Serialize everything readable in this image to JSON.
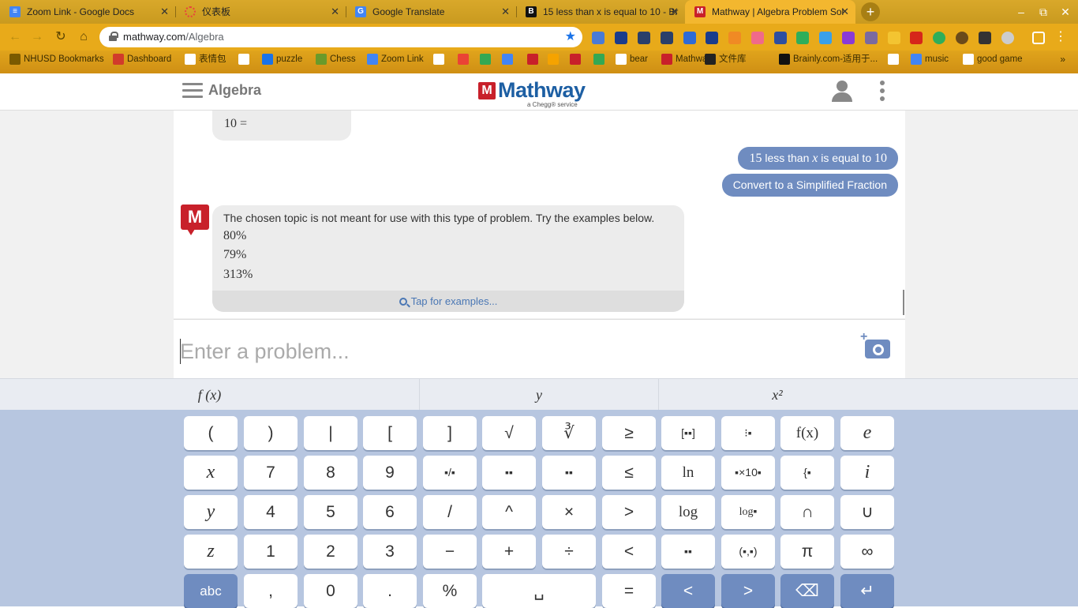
{
  "browser": {
    "tabs": [
      {
        "title": "Zoom Link - Google Docs",
        "color": "#4285f4",
        "active": false
      },
      {
        "title": "仪表板",
        "color": "#e8453c",
        "active": false
      },
      {
        "title": "Google Translate",
        "color": "#4285f4",
        "active": false
      },
      {
        "title": "15 less than x is equal to 10 - Br",
        "color": "#111111",
        "active": false
      },
      {
        "title": "Mathway | Algebra Problem Sol",
        "color": "#c8202a",
        "active": true
      }
    ],
    "new_tab": "+",
    "window_controls": [
      "–",
      "⧉",
      "✕"
    ],
    "address": {
      "host": "mathway.com",
      "path": "/Algebra"
    },
    "bookmarks": [
      {
        "label": "NHUSD Bookmarks",
        "color": "#7a5a00"
      },
      {
        "label": "Dashboard",
        "color": "#d13b2b"
      },
      {
        "label": "表情包",
        "color": "#ffffff"
      },
      {
        "label": "",
        "color": "#ffffff"
      },
      {
        "label": "puzzle",
        "color": "#1a73e8"
      },
      {
        "label": "Chess",
        "color": "#6a9a2a"
      },
      {
        "label": "Zoom Link",
        "color": "#4285f4"
      },
      {
        "label": "",
        "color": "#ffffff"
      },
      {
        "label": "",
        "color": "#ea4335"
      },
      {
        "label": "",
        "color": "#34a853"
      },
      {
        "label": "",
        "color": "#4285f4"
      },
      {
        "label": "",
        "color": "#c8202a"
      },
      {
        "label": "",
        "color": "#f5a300"
      },
      {
        "label": "",
        "color": "#c8202a"
      },
      {
        "label": "",
        "color": "#34a853"
      },
      {
        "label": "bear",
        "color": "#ffffff"
      },
      {
        "label": "Mathway",
        "color": "#c8202a"
      },
      {
        "label": "文件库",
        "color": "#222222"
      },
      {
        "label": "Brainly.com-适用于...",
        "color": "#111111"
      },
      {
        "label": "",
        "color": "#ffffff"
      },
      {
        "label": "music",
        "color": "#4285f4"
      },
      {
        "label": "good game",
        "color": "#ffffff"
      }
    ],
    "bookmarks_more": "»"
  },
  "site": {
    "topic": "Algebra",
    "logo_word": "Mathway",
    "logo_sub": "a Chegg® service"
  },
  "chat": {
    "previous_tail": "10 =",
    "user_problem": {
      "before": "15 less than ",
      "var": "x",
      "after": " is equal to ",
      "num": "10"
    },
    "user_topic": "Convert to a Simplified Fraction",
    "bot_message": "The chosen topic is not meant for use with this type of problem. Try the examples below.",
    "examples": [
      "80%",
      "79%",
      "313%"
    ],
    "tap_label": "Tap for examples..."
  },
  "input": {
    "placeholder": "Enter a problem..."
  },
  "keyboard": {
    "tabs": [
      "f (x)",
      "y",
      "x²"
    ],
    "rows": [
      [
        "(",
        ")",
        "|",
        "[",
        "]",
        "√",
        "∛",
        "≥",
        "[▪▪]",
        "⁝▪",
        "f(x)",
        "e"
      ],
      [
        "x",
        "7",
        "8",
        "9",
        "▪/▪",
        "▪▪",
        "▪▪",
        "≤",
        "ln",
        "▪×10▪",
        "{▪",
        "i"
      ],
      [
        "y",
        "4",
        "5",
        "6",
        "/",
        "^",
        "×",
        ">",
        "log",
        "log▪",
        "∩",
        "∪"
      ],
      [
        "z",
        "1",
        "2",
        "3",
        "−",
        "+",
        "÷",
        "<",
        "▪▪",
        "(▪,▪)",
        "π",
        "∞"
      ],
      [
        "abc",
        ",",
        "0",
        ".",
        "%",
        "␣",
        "=",
        "<",
        ">",
        "⌫",
        "↵"
      ]
    ]
  }
}
